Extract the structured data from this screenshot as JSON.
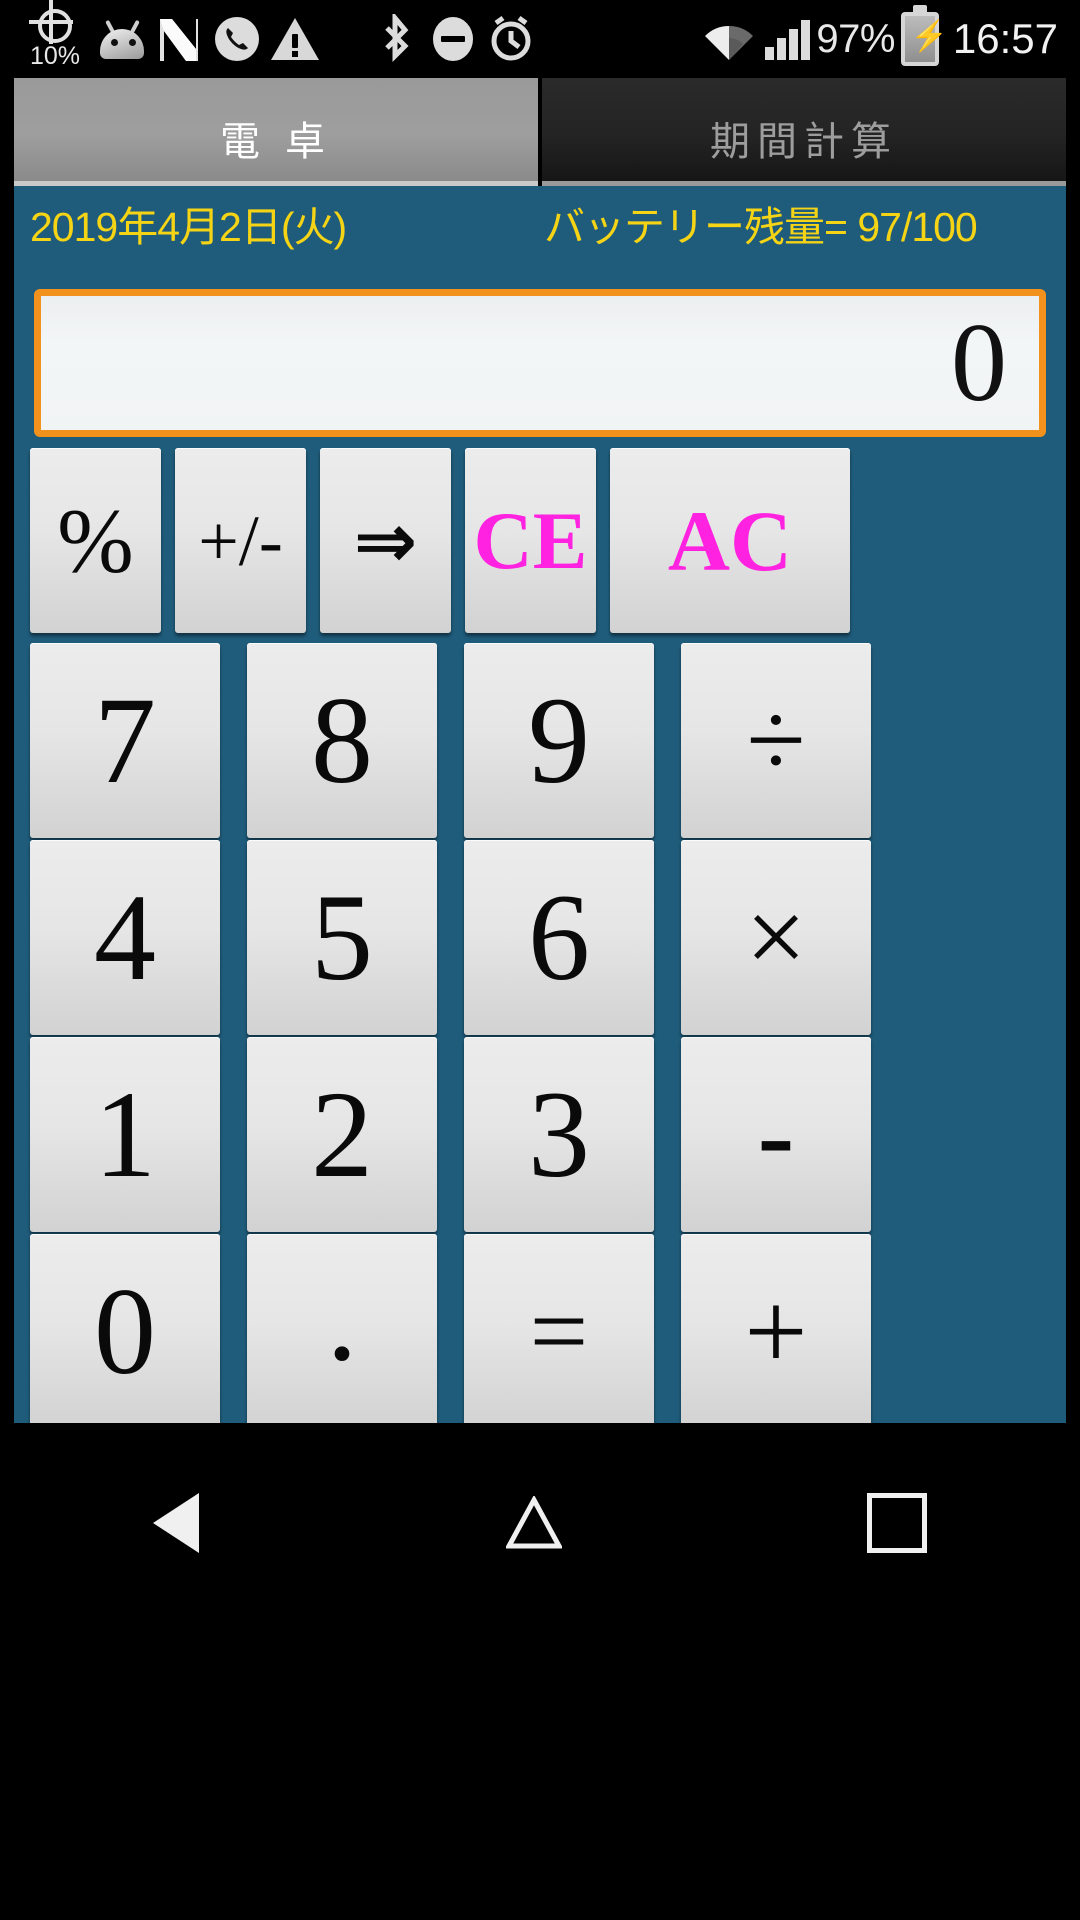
{
  "statusbar": {
    "brightness": "10%",
    "battery_percent": "97%",
    "time": "16:57",
    "icons": [
      "brightness-icon",
      "android-robot-icon",
      "nougat-n-icon",
      "phone-icon",
      "warning-triangle-icon",
      "bluetooth-icon",
      "do-not-disturb-icon",
      "alarm-clock-icon",
      "wifi-icon",
      "cellular-signal-icon",
      "battery-charging-icon"
    ]
  },
  "tabs": [
    {
      "label": "電 卓",
      "selected": true
    },
    {
      "label": "期間計算",
      "selected": false
    }
  ],
  "header": {
    "date": "2019年4月2日(火)",
    "battery_label": "バッテリー残量= 97/100"
  },
  "display": {
    "value": "0"
  },
  "function_row": [
    {
      "label": "%",
      "style": "k-pct",
      "width": "fw-s",
      "name": "percent-key"
    },
    {
      "label": "+/-",
      "style": "k-pm",
      "width": "fw-s",
      "name": "sign-toggle-key"
    },
    {
      "label": "⇒",
      "style": "k-arrow",
      "width": "fw-s",
      "name": "backspace-key"
    },
    {
      "label": "CE",
      "style": "k-ce",
      "width": "fw-s",
      "name": "clear-entry-key"
    },
    {
      "label": "AC",
      "style": "k-ac",
      "width": "fw-ac",
      "name": "all-clear-key"
    }
  ],
  "keypad": [
    [
      {
        "label": "7",
        "style": "k-digit",
        "name": "digit-7-key"
      },
      {
        "label": "8",
        "style": "k-digit",
        "name": "digit-8-key"
      },
      {
        "label": "9",
        "style": "k-digit",
        "name": "digit-9-key"
      },
      {
        "label": "÷",
        "style": "k-op",
        "name": "divide-key"
      }
    ],
    [
      {
        "label": "4",
        "style": "k-digit",
        "name": "digit-4-key"
      },
      {
        "label": "5",
        "style": "k-digit",
        "name": "digit-5-key"
      },
      {
        "label": "6",
        "style": "k-digit",
        "name": "digit-6-key"
      },
      {
        "label": "×",
        "style": "k-op",
        "name": "multiply-key"
      }
    ],
    [
      {
        "label": "1",
        "style": "k-digit",
        "name": "digit-1-key"
      },
      {
        "label": "2",
        "style": "k-digit",
        "name": "digit-2-key"
      },
      {
        "label": "3",
        "style": "k-digit",
        "name": "digit-3-key"
      },
      {
        "label": "-",
        "style": "k-minus",
        "name": "subtract-key"
      }
    ],
    [
      {
        "label": "0",
        "style": "k-digit",
        "name": "digit-0-key"
      },
      {
        "label": ".",
        "style": "k-dot",
        "name": "decimal-point-key"
      },
      {
        "label": "=",
        "style": "k-eq",
        "name": "equals-key"
      },
      {
        "label": "+",
        "style": "k-plus",
        "name": "add-key"
      }
    ]
  ],
  "navbar": {
    "back": "back-icon",
    "home": "home-icon",
    "recents": "recents-icon"
  },
  "colors": {
    "panel_blue": "#1f5c7b",
    "accent_orange": "#f2921d",
    "header_yellow": "#f5d415",
    "clear_magenta": "#ff22e0",
    "key_face": "#e6e6e6"
  }
}
